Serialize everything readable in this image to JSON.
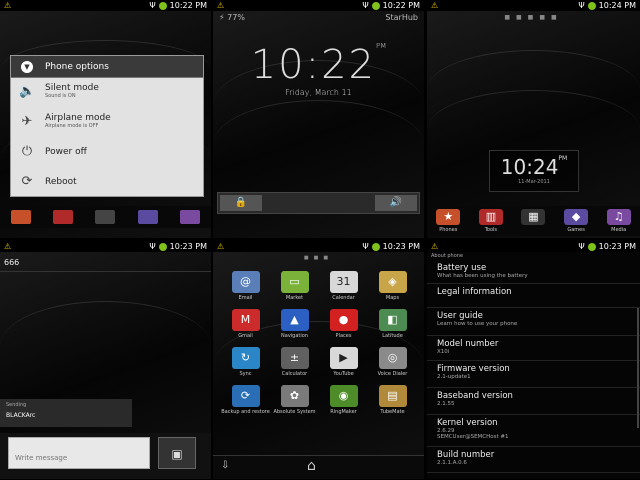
{
  "status": {
    "time1": "10:22 PM",
    "time2": "10:22 PM",
    "time3": "10:24 PM",
    "time4": "10:23 PM",
    "time5": "10:23 PM",
    "time6": "10:23 PM"
  },
  "phone_options": {
    "title": "Phone options",
    "items": [
      {
        "label": "Silent mode",
        "sub": "Sound is ON"
      },
      {
        "label": "Airplane mode",
        "sub": "Airplane mode is OFF"
      },
      {
        "label": "Power off",
        "sub": ""
      },
      {
        "label": "Reboot",
        "sub": ""
      }
    ]
  },
  "lockscreen": {
    "battery": "77%",
    "carrier": "StarHub",
    "time": "10:22",
    "ampm": "PM",
    "date": "Friday, March 11"
  },
  "home": {
    "time": "10:24",
    "ampm": "PM",
    "date": "11-Mar-2011",
    "dock": [
      "Phones",
      "Tools",
      "",
      "Games",
      "Media"
    ]
  },
  "sms": {
    "recipient": "666",
    "status_label": "Sending",
    "status_value": "BLACKArc",
    "placeholder": "Write message"
  },
  "apps": [
    {
      "name": "Email",
      "icon": "@",
      "color": "#5a7fb8"
    },
    {
      "name": "Market",
      "icon": "▭",
      "color": "#7bb33a"
    },
    {
      "name": "Calendar",
      "icon": "31",
      "color": "#d8d8d8"
    },
    {
      "name": "Maps",
      "icon": "◈",
      "color": "#c9a54a"
    },
    {
      "name": "Gmail",
      "icon": "M",
      "color": "#cc2b2b"
    },
    {
      "name": "Navigation",
      "icon": "▲",
      "color": "#2b5fc2"
    },
    {
      "name": "Places",
      "icon": "●",
      "color": "#d32020"
    },
    {
      "name": "Latitude",
      "icon": "◧",
      "color": "#4c8c52"
    },
    {
      "name": "Sync",
      "icon": "↻",
      "color": "#2a86c7"
    },
    {
      "name": "Calculator",
      "icon": "±",
      "color": "#606060"
    },
    {
      "name": "YouTube",
      "icon": "▶",
      "color": "#d8d8d8"
    },
    {
      "name": "Voice Dialer",
      "icon": "◎",
      "color": "#8a8a8a"
    },
    {
      "name": "Backup and restore",
      "icon": "⟳",
      "color": "#2a6fb5"
    },
    {
      "name": "Absolute System",
      "icon": "✿",
      "color": "#7a7a7a"
    },
    {
      "name": "RingMaker",
      "icon": "◉",
      "color": "#4e8c2a"
    },
    {
      "name": "TubeMate",
      "icon": "▤",
      "color": "#b08a3a"
    }
  ],
  "about": {
    "header": "About phone",
    "items": [
      {
        "label": "Battery use",
        "sub": "What has been using the battery"
      },
      {
        "label": "Legal information",
        "sub": ""
      },
      {
        "label": "User guide",
        "sub": "Learn how to use your phone"
      },
      {
        "label": "Model number",
        "sub": "X10i"
      },
      {
        "label": "Firmware version",
        "sub": "2.1-update1"
      },
      {
        "label": "Baseband version",
        "sub": "2.1.55"
      },
      {
        "label": "Kernel version",
        "sub": "2.6.29\nSEMCUser@SEMCHost #1"
      },
      {
        "label": "Build number",
        "sub": "2.1.1.A.0.6"
      }
    ]
  }
}
